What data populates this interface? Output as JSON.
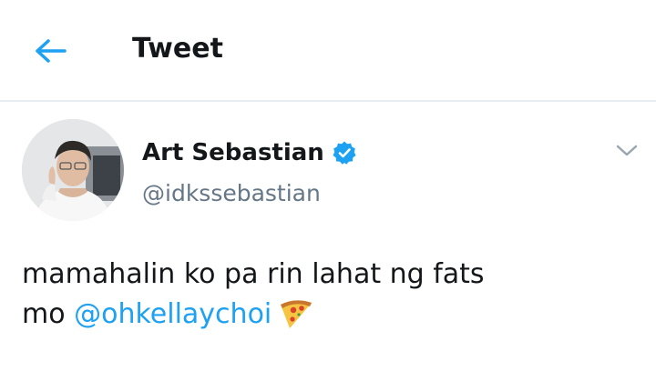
{
  "header": {
    "title": "Tweet",
    "back_icon": "arrow-left-icon"
  },
  "colors": {
    "accent": "#1da1f2",
    "text": "#14171a",
    "secondary": "#657786",
    "divider": "#e6ecf0"
  },
  "tweet": {
    "author_name": "Art Sebastian",
    "verified": true,
    "handle": "@idkssebastian",
    "text_line1": "mamahalin ko pa rin lahat ng fats",
    "text_line2_prefix": "mo ",
    "mention": "@ohkellaychoi",
    "emoji": "pizza-icon"
  }
}
